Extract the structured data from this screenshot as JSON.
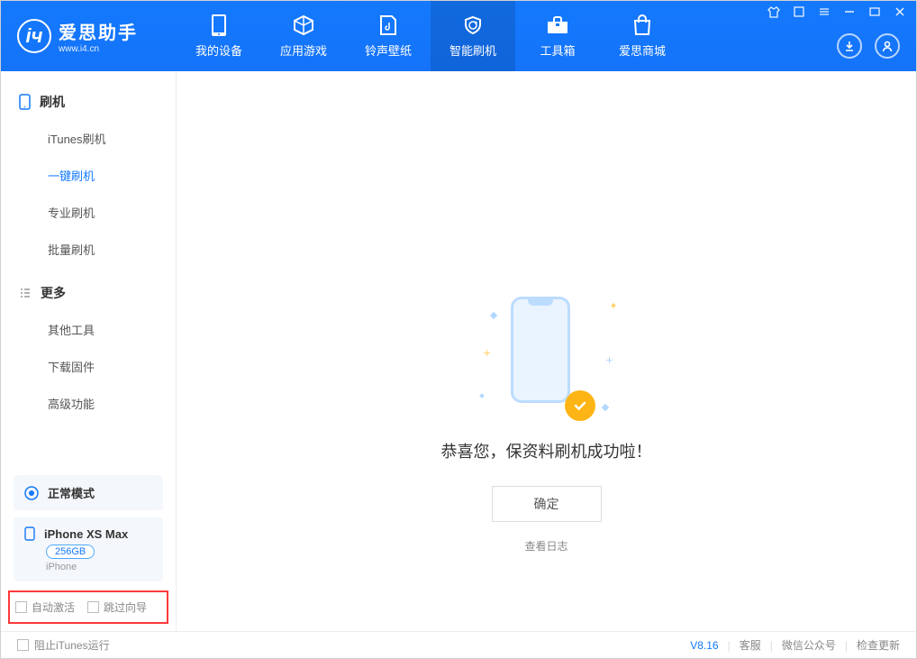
{
  "brand": {
    "title": "爱思助手",
    "url": "www.i4.cn"
  },
  "nav": {
    "device": "我的设备",
    "apps": "应用游戏",
    "ringtone": "铃声壁纸",
    "flash": "智能刷机",
    "toolbox": "工具箱",
    "store": "爱思商城"
  },
  "sidebar": {
    "group_flash": "刷机",
    "items_flash": {
      "itunes": "iTunes刷机",
      "oneclick": "一键刷机",
      "pro": "专业刷机",
      "batch": "批量刷机"
    },
    "group_more": "更多",
    "items_more": {
      "other": "其他工具",
      "firmware": "下载固件",
      "advanced": "高级功能"
    }
  },
  "device_status": {
    "mode_label": "正常模式",
    "name": "iPhone XS Max",
    "storage": "256GB",
    "type": "iPhone"
  },
  "bottom_checks": {
    "auto_activate": "自动激活",
    "skip_wizard": "跳过向导"
  },
  "content": {
    "success_title": "恭喜您，保资料刷机成功啦！",
    "confirm": "确定",
    "view_log": "查看日志"
  },
  "footer": {
    "block_itunes": "阻止iTunes运行",
    "version": "V8.16",
    "support": "客服",
    "wechat": "微信公众号",
    "update": "检查更新"
  }
}
